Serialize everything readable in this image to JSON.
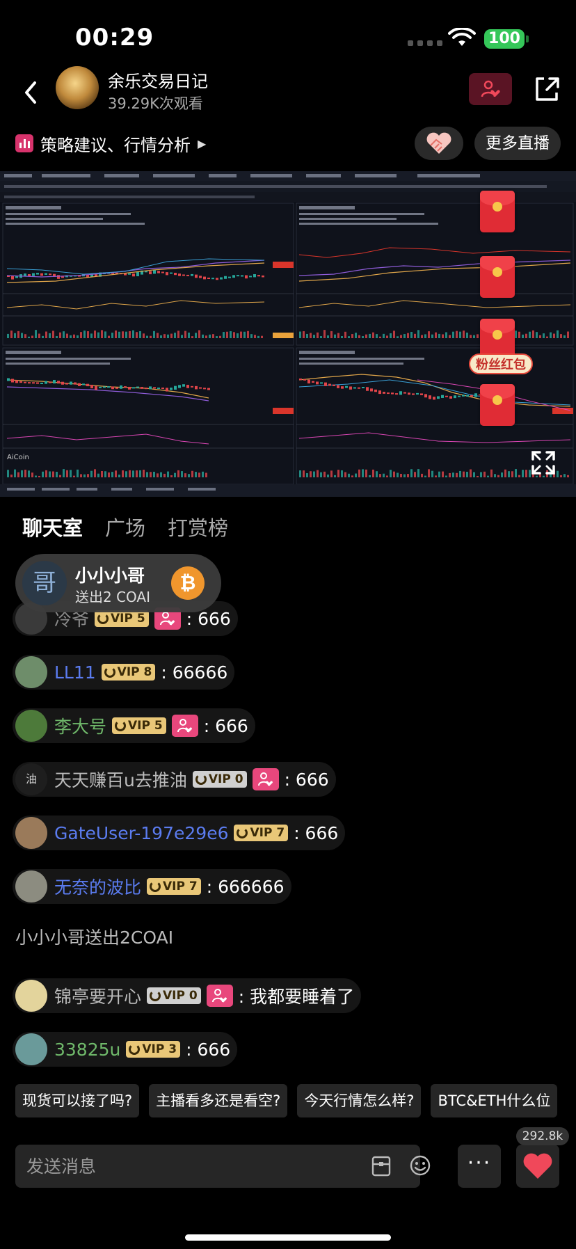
{
  "status": {
    "time": "00:29",
    "battery": "100"
  },
  "header": {
    "streamer_name": "余乐交易日记",
    "views": "39.29K次观看"
  },
  "topic": {
    "label": "策略建议、行情分析"
  },
  "buttons": {
    "more_live": "更多直播"
  },
  "video": {
    "fan_redpack_label": "粉丝红包",
    "panels": [
      {
        "title": "BTC/USDT 币安",
        "price_tag": "91195.40",
        "last": "93892.00",
        "low": "88114.00"
      },
      {
        "title": "ETH/USDT 币安",
        "price_tag": "",
        "last": "3099.00",
        "low": "2903.78"
      },
      {
        "title": "BTC/USDT 币安",
        "price_tag": "91193.40",
        "last": "91111.00",
        "low": ""
      },
      {
        "title": "ETH/USDT 币安",
        "price_tag": "",
        "last": "3027.02",
        "low": ""
      }
    ],
    "watermark": "AiCoin"
  },
  "tabs": [
    "聊天室",
    "广场",
    "打赏榜"
  ],
  "gift_toast": {
    "avatar_char": "哥",
    "name": "小小小哥",
    "text": "送出2 COAI",
    "coin_symbol": "₿"
  },
  "messages": [
    {
      "name": "冷爷",
      "vip": "VIP 5",
      "fan": true,
      "text": ": 666",
      "name_color": "#8a8a8a"
    },
    {
      "name": "LL11",
      "vip": "VIP 8",
      "fan": false,
      "text": ": 66666",
      "name_color": "#5b7cf0"
    },
    {
      "name": "李大号",
      "vip": "VIP 5",
      "fan": true,
      "text": ": 666",
      "name_color": "#6fb86a"
    },
    {
      "name": "天天赚百u去推油",
      "vip": "VIP 0",
      "fan": true,
      "text": ": 666",
      "name_color": "#bbbbbb",
      "avatar_char": "油"
    },
    {
      "name": "GateUser-197e29e6",
      "vip": "VIP 7",
      "fan": false,
      "text": ": 666",
      "name_color": "#5b7cf0"
    },
    {
      "name": "无奈的波比",
      "vip": "VIP 7",
      "fan": false,
      "text": ": 666666",
      "name_color": "#5b7cf0"
    },
    {
      "name": "锦亭要开心",
      "vip": "VIP 0",
      "fan": true,
      "text": ": 我都要睡着了",
      "name_color": "#bbbbbb"
    },
    {
      "name": "33825u",
      "vip": "VIP 3",
      "fan": false,
      "text": ": 666",
      "name_color": "#6fb86a"
    }
  ],
  "system_message": "小小小哥送出2COAI",
  "quick_replies": [
    "现货可以接了吗?",
    "主播看多还是看空?",
    "今天行情怎么样?",
    "BTC&ETH什么位"
  ],
  "input": {
    "placeholder": "发送消息"
  },
  "like_count": "292.8k",
  "colors": {
    "fan_badge": "#e8477c",
    "like_heart": "#f0485a",
    "vip_gold": "#e9c778",
    "vip_silver": "#d0d0d0"
  }
}
